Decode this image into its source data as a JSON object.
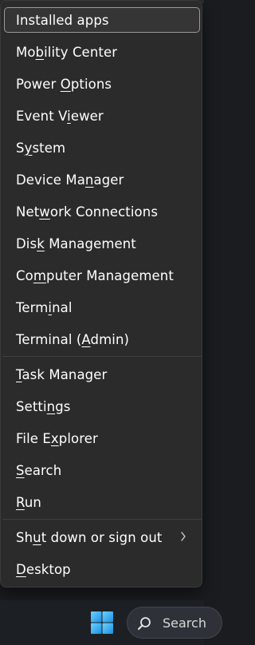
{
  "menu": {
    "items": [
      {
        "label": "Installed apps",
        "selected": true
      },
      {
        "label": "Mobility Center",
        "accel_index": 2
      },
      {
        "label": "Power Options",
        "accel_index": 6
      },
      {
        "label": "Event Viewer",
        "accel_index": 7
      },
      {
        "label": "System",
        "accel_index": 1
      },
      {
        "label": "Device Manager",
        "accel_index": 9
      },
      {
        "label": "Network Connections",
        "accel_index": 3
      },
      {
        "label": "Disk Management",
        "accel_index": 3
      },
      {
        "label": "Computer Management",
        "accel_index": 2
      },
      {
        "label": "Terminal",
        "accel_index": 4
      },
      {
        "label": "Terminal (Admin)",
        "accel_index": 10
      },
      {
        "label": "Task Manager",
        "accel_index": 0
      },
      {
        "label": "Settings",
        "accel_index": 5
      },
      {
        "label": "File Explorer",
        "accel_index": 6
      },
      {
        "label": "Search",
        "accel_index": 0
      },
      {
        "label": "Run",
        "accel_index": 0
      },
      {
        "label": "Shut down or sign out",
        "accel_index": 2,
        "submenu": true
      },
      {
        "label": "Desktop",
        "accel_index": 0
      }
    ]
  },
  "taskbar": {
    "search_label": "Search",
    "start_icon": "windows-logo-icon",
    "search_icon": "search-icon"
  },
  "colors": {
    "menu_bg": "#2b2b2b",
    "text": "#ffffff",
    "start_blue": "#3fb6f5"
  }
}
